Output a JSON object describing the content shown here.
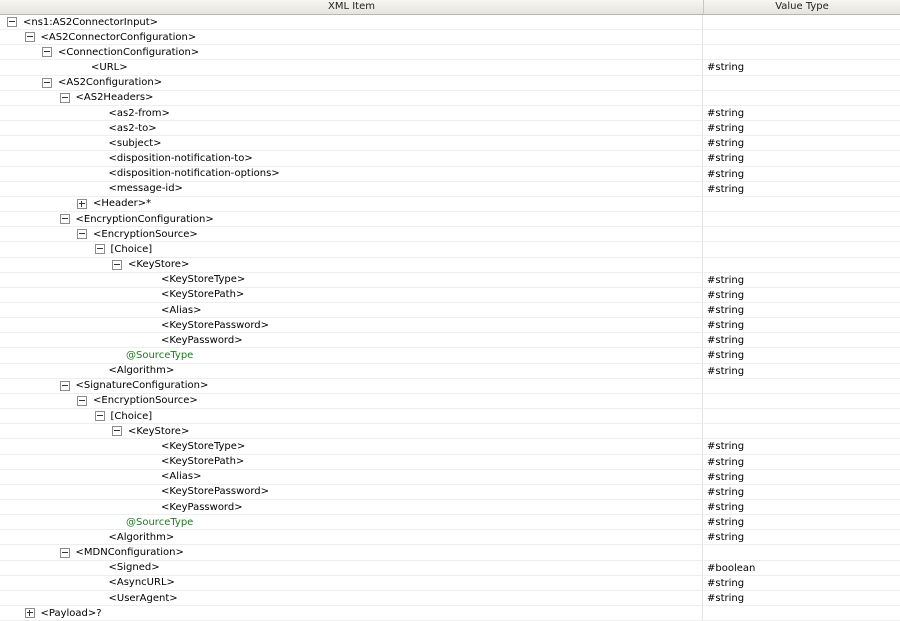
{
  "header": {
    "col_item": "XML Item",
    "col_type": "Value Type"
  },
  "rows": [
    {
      "label": "<ns1:AS2ConnectorInput>",
      "type": "",
      "level": 0,
      "toggle": "minus"
    },
    {
      "label": "<AS2ConnectorConfiguration>",
      "type": "",
      "level": 1,
      "toggle": "minus"
    },
    {
      "label": "<ConnectionConfiguration>",
      "type": "",
      "level": 2,
      "toggle": "minus"
    },
    {
      "label": "<URL>",
      "type": "#string",
      "level": 4,
      "toggle": ""
    },
    {
      "label": "<AS2Configuration>",
      "type": "",
      "level": 2,
      "toggle": "minus"
    },
    {
      "label": "<AS2Headers>",
      "type": "",
      "level": 3,
      "toggle": "minus"
    },
    {
      "label": "<as2-from>",
      "type": "#string",
      "level": 5,
      "toggle": ""
    },
    {
      "label": "<as2-to>",
      "type": "#string",
      "level": 5,
      "toggle": ""
    },
    {
      "label": "<subject>",
      "type": "#string",
      "level": 5,
      "toggle": ""
    },
    {
      "label": "<disposition-notification-to>",
      "type": "#string",
      "level": 5,
      "toggle": ""
    },
    {
      "label": "<disposition-notification-options>",
      "type": "#string",
      "level": 5,
      "toggle": ""
    },
    {
      "label": "<message-id>",
      "type": "#string",
      "level": 5,
      "toggle": ""
    },
    {
      "label": "<Header>*",
      "type": "",
      "level": 4,
      "toggle": "plus"
    },
    {
      "label": "<EncryptionConfiguration>",
      "type": "",
      "level": 3,
      "toggle": "minus"
    },
    {
      "label": "<EncryptionSource>",
      "type": "",
      "level": 4,
      "toggle": "minus"
    },
    {
      "label": "[Choice]",
      "type": "",
      "level": 5,
      "toggle": "minus"
    },
    {
      "label": "<KeyStore>",
      "type": "",
      "level": 6,
      "toggle": "minus"
    },
    {
      "label": "<KeyStoreType>",
      "type": "#string",
      "level": 8,
      "toggle": ""
    },
    {
      "label": "<KeyStorePath>",
      "type": "#string",
      "level": 8,
      "toggle": ""
    },
    {
      "label": "<Alias>",
      "type": "#string",
      "level": 8,
      "toggle": ""
    },
    {
      "label": "<KeyStorePassword>",
      "type": "#string",
      "level": 8,
      "toggle": ""
    },
    {
      "label": "<KeyPassword>",
      "type": "#string",
      "level": 8,
      "toggle": ""
    },
    {
      "label": "@SourceType",
      "type": "#string",
      "level": 6,
      "toggle": "",
      "attr": true
    },
    {
      "label": "<Algorithm>",
      "type": "#string",
      "level": 5,
      "toggle": ""
    },
    {
      "label": "<SignatureConfiguration>",
      "type": "",
      "level": 3,
      "toggle": "minus"
    },
    {
      "label": "<EncryptionSource>",
      "type": "",
      "level": 4,
      "toggle": "minus"
    },
    {
      "label": "[Choice]",
      "type": "",
      "level": 5,
      "toggle": "minus"
    },
    {
      "label": "<KeyStore>",
      "type": "",
      "level": 6,
      "toggle": "minus"
    },
    {
      "label": "<KeyStoreType>",
      "type": "#string",
      "level": 8,
      "toggle": ""
    },
    {
      "label": "<KeyStorePath>",
      "type": "#string",
      "level": 8,
      "toggle": ""
    },
    {
      "label": "<Alias>",
      "type": "#string",
      "level": 8,
      "toggle": ""
    },
    {
      "label": "<KeyStorePassword>",
      "type": "#string",
      "level": 8,
      "toggle": ""
    },
    {
      "label": "<KeyPassword>",
      "type": "#string",
      "level": 8,
      "toggle": ""
    },
    {
      "label": "@SourceType",
      "type": "#string",
      "level": 6,
      "toggle": "",
      "attr": true
    },
    {
      "label": "<Algorithm>",
      "type": "#string",
      "level": 5,
      "toggle": ""
    },
    {
      "label": "<MDNConfiguration>",
      "type": "",
      "level": 3,
      "toggle": "minus"
    },
    {
      "label": "<Signed>",
      "type": "#boolean",
      "level": 5,
      "toggle": ""
    },
    {
      "label": "<AsyncURL>",
      "type": "#string",
      "level": 5,
      "toggle": ""
    },
    {
      "label": "<UserAgent>",
      "type": "#string",
      "level": 5,
      "toggle": ""
    },
    {
      "label": "<Payload>?",
      "type": "",
      "level": 1,
      "toggle": "plus"
    }
  ]
}
